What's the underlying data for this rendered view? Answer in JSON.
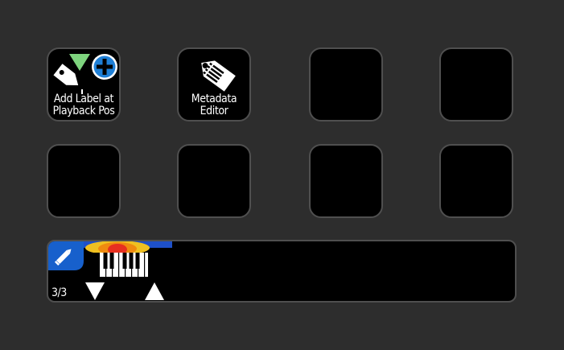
{
  "keys": [
    {
      "name": "add-label-at-playback-pos-button",
      "label": "Add Label at\nPlayback Pos",
      "icon": "tag-plus-icon"
    },
    {
      "name": "metadata-editor-button",
      "label": "Metadata\nEditor",
      "icon": "tag-list-icon"
    },
    {
      "name": "empty-key",
      "label": "",
      "icon": ""
    },
    {
      "name": "empty-key",
      "label": "",
      "icon": ""
    },
    {
      "name": "empty-key",
      "label": "",
      "icon": ""
    },
    {
      "name": "empty-key",
      "label": "",
      "icon": ""
    },
    {
      "name": "empty-key",
      "label": "",
      "icon": ""
    },
    {
      "name": "empty-key",
      "label": "",
      "icon": ""
    }
  ],
  "strip": {
    "page_indicator": "3/3",
    "icons": [
      "pencil-icon",
      "piano-keys-icon",
      "arrow-down-icon",
      "arrow-up-icon"
    ]
  },
  "colors": {
    "background": "#2d2d2d",
    "key_border": "#4f4f4f",
    "plus_badge": "#1e7fd6",
    "triangle_green": "#7ed47e",
    "pencil_bg": "#1760cc"
  }
}
